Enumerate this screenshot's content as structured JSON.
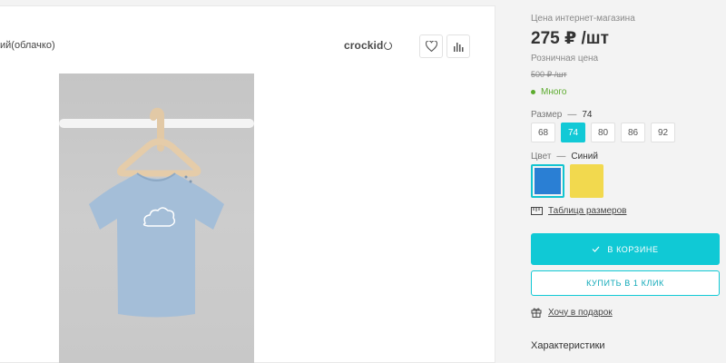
{
  "product": {
    "title_fragment": "ий(облачко)",
    "brand": "crockid"
  },
  "pricing": {
    "online_label": "Цена интернет-магазина",
    "online_price": "275 ₽ /шт",
    "retail_label": "Розничная цена",
    "retail_price": "500 ₽ /шт",
    "stock": "Много"
  },
  "size": {
    "label": "Размер",
    "dash": "—",
    "selected": "74",
    "options": [
      "68",
      "74",
      "80",
      "86",
      "92"
    ]
  },
  "color": {
    "label": "Цвет",
    "dash": "—",
    "selected": "Синий",
    "swatches": [
      "#2a7fd4",
      "#f2d94e"
    ]
  },
  "links": {
    "size_table": "Таблица размеров",
    "gift": "Хочу в подарок"
  },
  "buttons": {
    "cart": "В КОРЗИНЕ",
    "one_click": "КУПИТЬ В 1 КЛИК"
  },
  "sections": {
    "characteristics": "Характеристики"
  },
  "colors": {
    "accent": "#10c9d5",
    "stock_green": "#5cab2e"
  }
}
